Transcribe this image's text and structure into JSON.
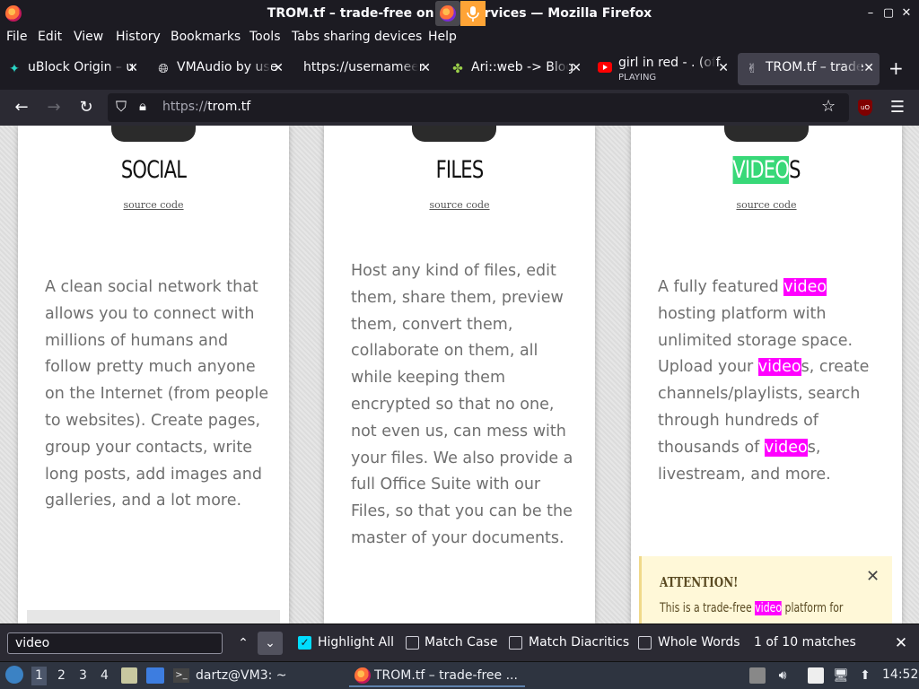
{
  "window": {
    "title": "TROM.tf – trade-free online services — Mozilla Firefox",
    "title_left": "TROM.tf – trade-free on",
    "title_right": "rvices — Mozilla Firefox",
    "controls": {
      "minimize": "–",
      "maximize": "▢",
      "close": "✕"
    }
  },
  "menubar": {
    "items": [
      "File",
      "Edit",
      "View",
      "History",
      "Bookmarks",
      "Tools",
      "Tabs sharing devices",
      "Help"
    ]
  },
  "tabs": [
    {
      "label": "uBlock Origin – u",
      "icon": "ublock-icon"
    },
    {
      "label": "VMAudio by use",
      "icon": "globe-icon"
    },
    {
      "label": "https://usernameer",
      "icon": ""
    },
    {
      "label": "Ari::web -> Blog",
      "icon": "ari-icon"
    },
    {
      "label": "girl in red - . (off",
      "sublabel": "PLAYING",
      "icon": "youtube-icon"
    },
    {
      "label": "TROM.tf – trade",
      "icon": "trom-icon",
      "active": true
    }
  ],
  "navbar": {
    "url_prefix": "https://",
    "url_host": "trom.tf"
  },
  "cards": [
    {
      "heading": "SOCIAL",
      "source": "source code",
      "desc": "A clean social network that allows you to connect with millions of humans and follow pretty much anyone on the Internet (from people to websites). Create pages, group your contacts, write long posts, add images and galleries, and a lot more."
    },
    {
      "heading": "FILES",
      "source": "source code",
      "desc": "Host any kind of files, edit them, share them, preview them, convert them, collaborate on them, all while keeping them encrypted so that no one, not even us, can mess with your files. We also provide a full Office Suite with our Files, so that you can be the master of your documents."
    },
    {
      "heading_hl": "VIDEO",
      "heading_rest": "S",
      "source": "source code",
      "desc_parts": [
        "A fully featured ",
        "video",
        " hosting platform with unlimited storage space. Upload your ",
        "video",
        "s, create channels/playlists, search through hundreds of thousands of ",
        "video",
        "s, livestream, and more."
      ]
    }
  ],
  "attention": {
    "title": "ATTENTION!",
    "text_before": "This is a trade-free ",
    "text_hl": "video",
    "text_after": " platform for",
    "close": "✕"
  },
  "findbar": {
    "query": "video",
    "highlight_all": "Highlight All",
    "match_case": "Match Case",
    "match_diacritics": "Match Diacritics",
    "whole_words": "Whole Words",
    "result": "1 of 10 matches",
    "highlight_all_checked": true
  },
  "taskbar": {
    "workspaces": [
      "1",
      "2",
      "3",
      "4"
    ],
    "terminal_label": "dartz@VM3: ~",
    "firefox_label": "TROM.tf – trade-free ...",
    "clock": "14:52"
  },
  "colors": {
    "highlight": "#ff00ff",
    "highlight_current": "#38d878",
    "chrome_bg": "#1c1b22",
    "toolbar_bg": "#2b2a33"
  }
}
